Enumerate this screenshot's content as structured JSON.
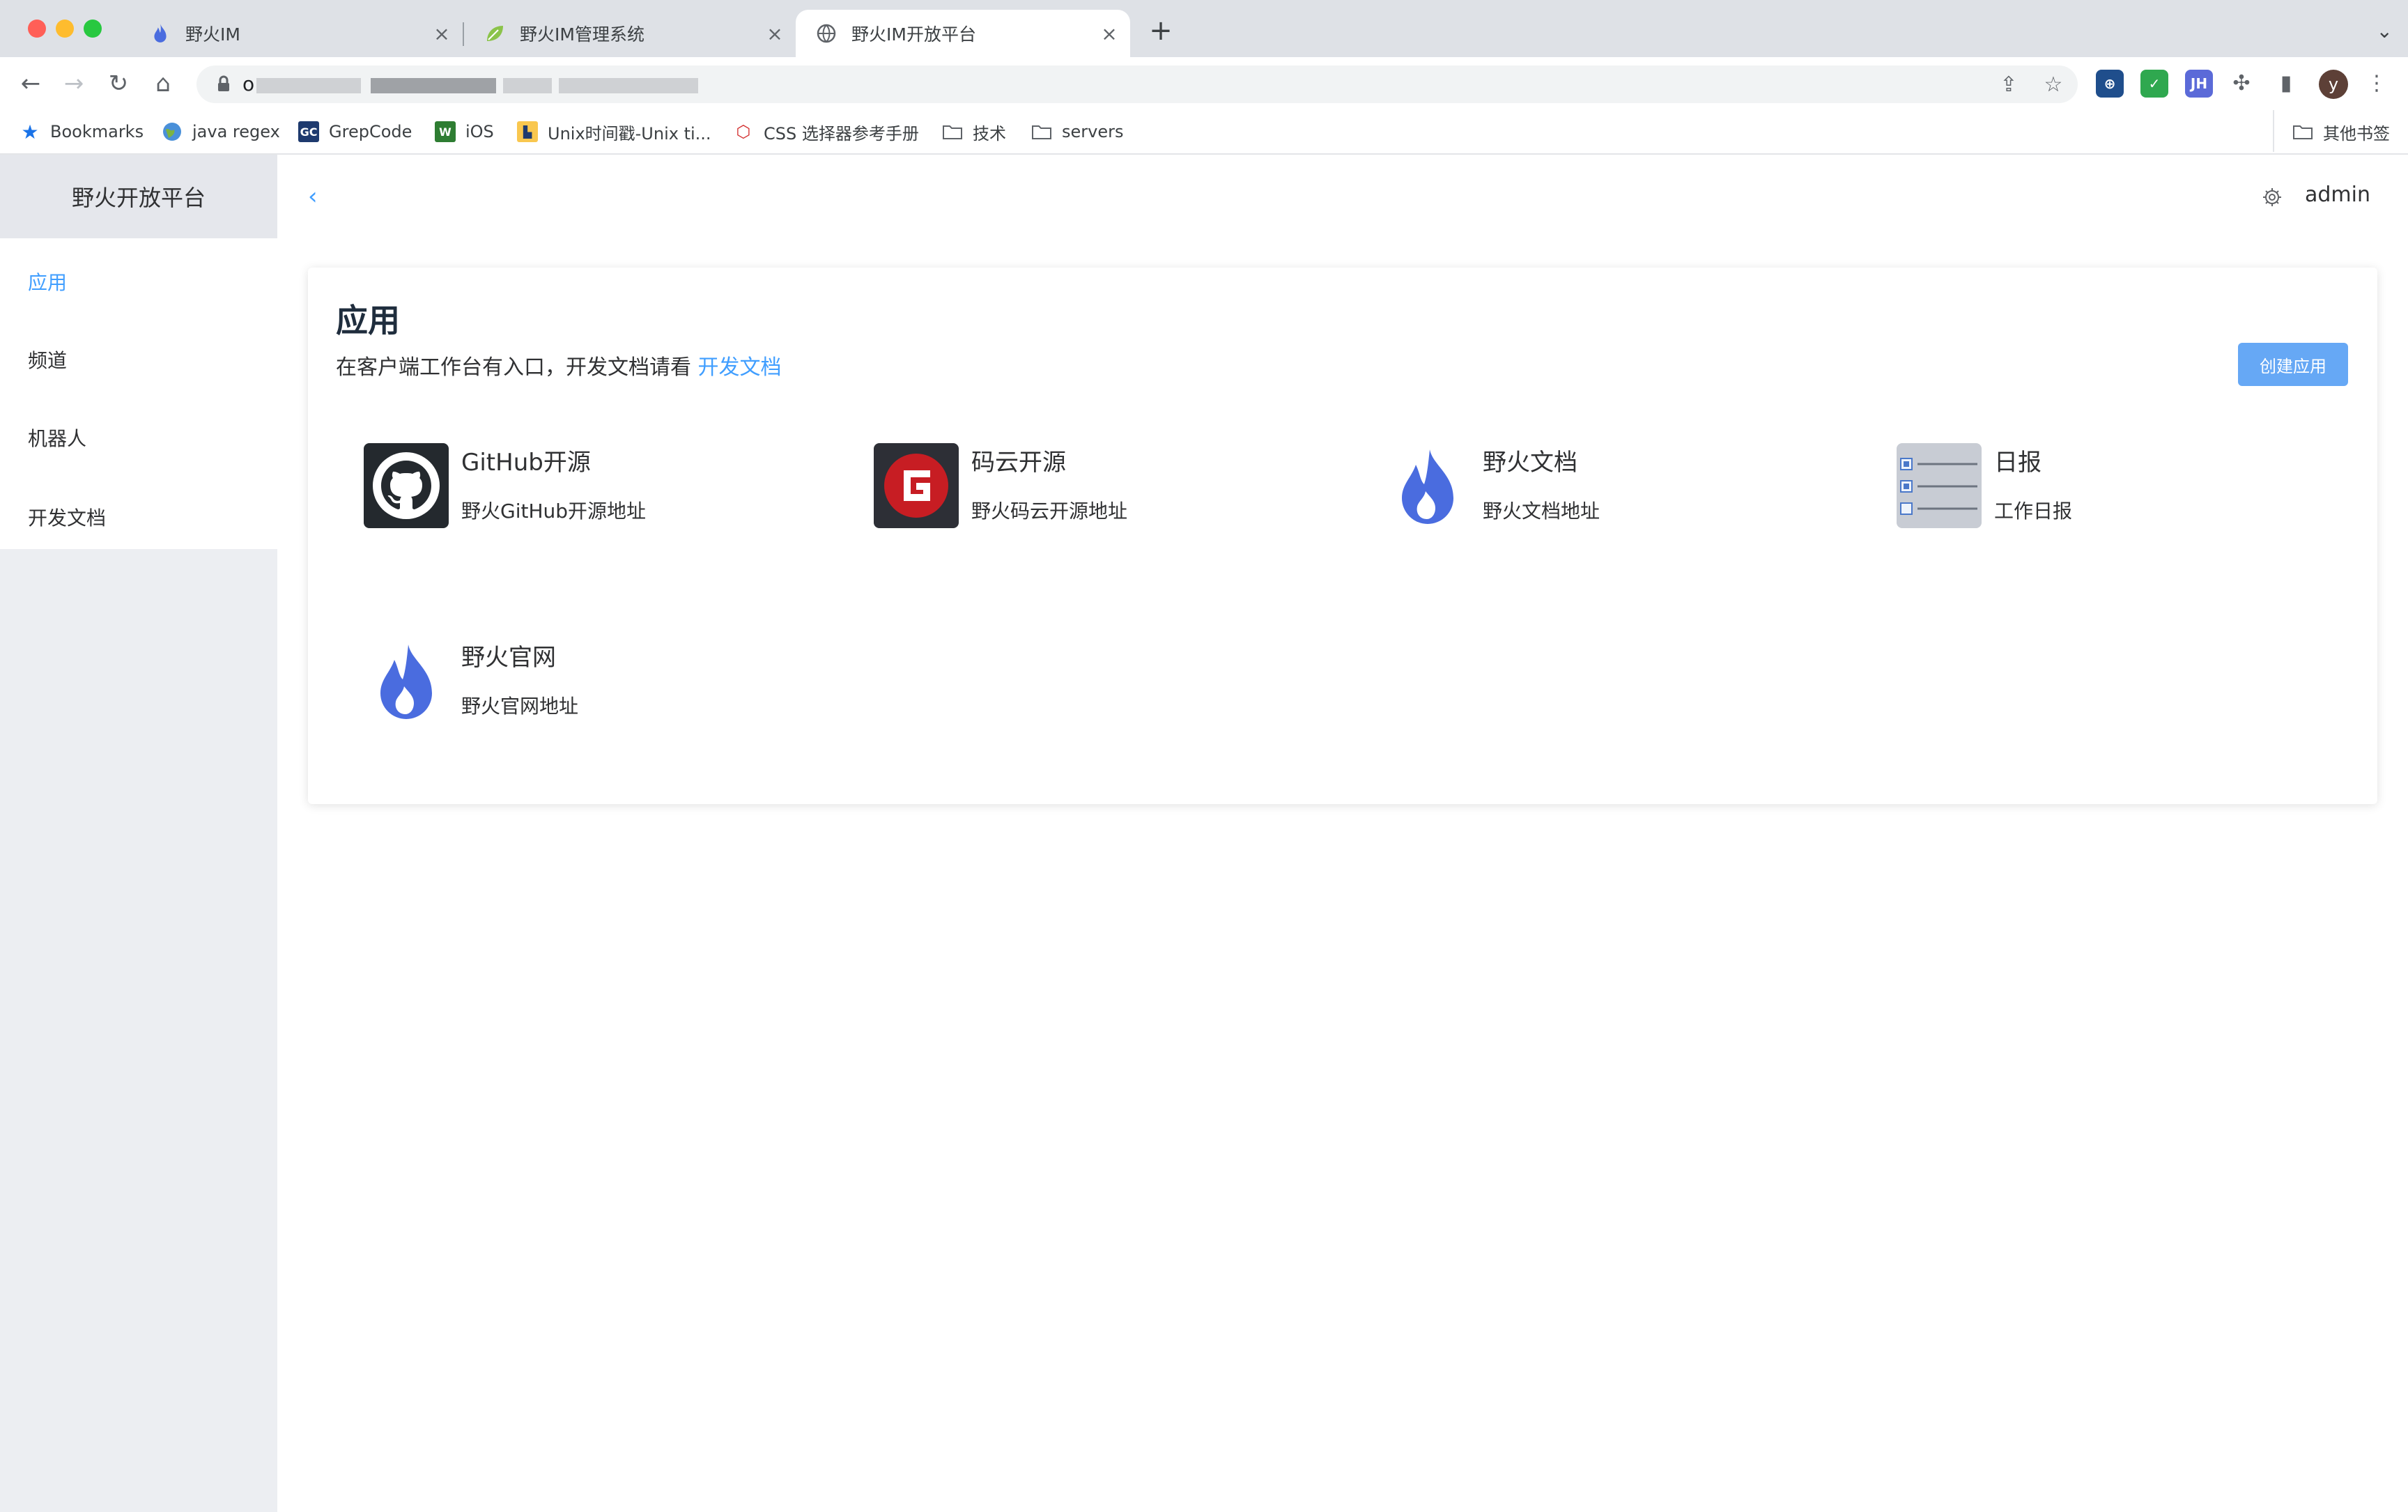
{
  "browser": {
    "tabs": [
      {
        "title": "野火IM",
        "icon": "flame-icon"
      },
      {
        "title": "野火IM管理系统",
        "icon": "leaf-icon"
      },
      {
        "title": "野火IM开放平台",
        "icon": "globe-icon",
        "active": true
      }
    ],
    "url": "o",
    "bookmarks": [
      {
        "label": "Bookmarks",
        "icon": "star-icon"
      },
      {
        "label": "java regex",
        "icon": "globe-icon"
      },
      {
        "label": "GrepCode",
        "icon": "gc-icon"
      },
      {
        "label": "iOS",
        "icon": "w-icon"
      },
      {
        "label": "Unix时间戳-Unix ti...",
        "icon": "chart-icon"
      },
      {
        "label": "CSS 选择器参考手册",
        "icon": "css-icon"
      },
      {
        "label": "技术",
        "icon": "folder-icon"
      },
      {
        "label": "servers",
        "icon": "folder-icon"
      }
    ],
    "other_bookmarks": "其他书签",
    "extensions": [
      "translate-ext",
      "shield-ext",
      "jh-ext"
    ],
    "profile_initial": "y"
  },
  "sidebar": {
    "title": "野火开放平台",
    "items": [
      {
        "label": "应用",
        "active": true
      },
      {
        "label": "频道"
      },
      {
        "label": "机器人"
      },
      {
        "label": "开发文档"
      }
    ]
  },
  "header": {
    "collapse_icon": "chevron-left-icon",
    "user": "admin"
  },
  "page": {
    "title": "应用",
    "subtitle": "在客户端工作台有入口，开发文档请看",
    "doc_link": "开发文档",
    "create_button": "创建应用",
    "apps": [
      {
        "name": "GitHub开源",
        "desc": "野火GitHub开源地址",
        "icon": "github-icon"
      },
      {
        "name": "码云开源",
        "desc": "野火码云开源地址",
        "icon": "gitee-icon"
      },
      {
        "name": "野火文档",
        "desc": "野火文档地址",
        "icon": "flame-icon"
      },
      {
        "name": "日报",
        "desc": "工作日报",
        "icon": "checklist-icon"
      },
      {
        "name": "野火官网",
        "desc": "野火官网地址",
        "icon": "flame-icon"
      }
    ]
  },
  "colors": {
    "accent": "#409eff",
    "button": "#66a8f5",
    "flame": "#4a6cdf",
    "gitee": "#c71d23"
  }
}
